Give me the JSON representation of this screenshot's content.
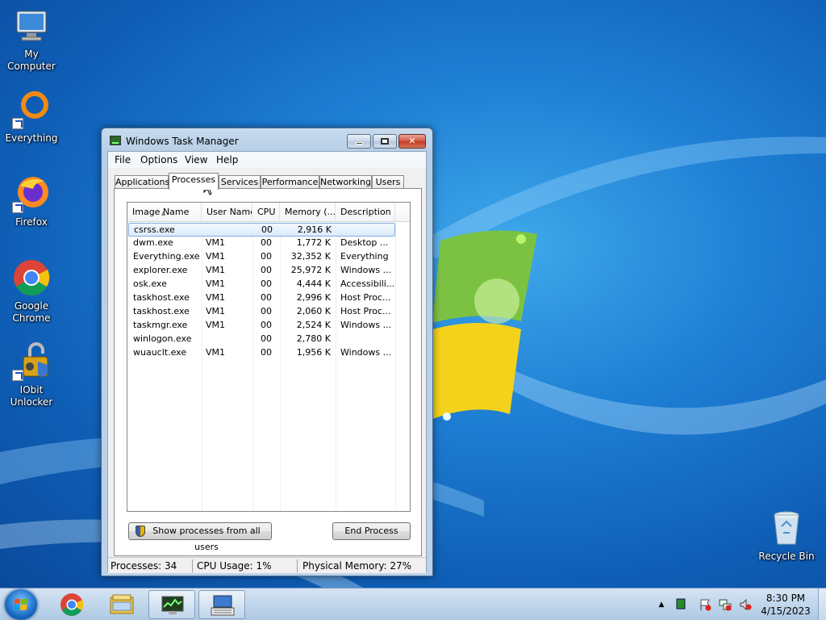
{
  "desktop": {
    "icons": [
      {
        "label": "My Computer"
      },
      {
        "label": "Everything"
      },
      {
        "label": "Firefox"
      },
      {
        "label": "Google Chrome"
      },
      {
        "label": "IObit Unlocker"
      },
      {
        "label": "Recycle Bin"
      }
    ]
  },
  "window": {
    "title": "Windows Task Manager",
    "close_glyph": "✕",
    "menus": [
      "File",
      "Options",
      "View",
      "Help"
    ],
    "tabs": [
      "Applications",
      "Processes",
      "Services",
      "Performance",
      "Networking",
      "Users"
    ],
    "active_tab": "Processes",
    "columns": [
      "Image Name",
      "User Name",
      "CPU",
      "Memory (...",
      "Description"
    ],
    "rows": [
      {
        "image": "csrss.exe",
        "user": "",
        "cpu": "00",
        "memory": "2,916 K",
        "desc": ""
      },
      {
        "image": "dwm.exe",
        "user": "VM1",
        "cpu": "00",
        "memory": "1,772 K",
        "desc": "Desktop ..."
      },
      {
        "image": "Everything.exe",
        "user": "VM1",
        "cpu": "00",
        "memory": "32,352 K",
        "desc": "Everything"
      },
      {
        "image": "explorer.exe",
        "user": "VM1",
        "cpu": "00",
        "memory": "25,972 K",
        "desc": "Windows ..."
      },
      {
        "image": "osk.exe",
        "user": "VM1",
        "cpu": "00",
        "memory": "4,444 K",
        "desc": "Accessibili..."
      },
      {
        "image": "taskhost.exe",
        "user": "VM1",
        "cpu": "00",
        "memory": "2,996 K",
        "desc": "Host Proc..."
      },
      {
        "image": "taskhost.exe",
        "user": "VM1",
        "cpu": "00",
        "memory": "2,060 K",
        "desc": "Host Proc..."
      },
      {
        "image": "taskmgr.exe",
        "user": "VM1",
        "cpu": "00",
        "memory": "2,524 K",
        "desc": "Windows ..."
      },
      {
        "image": "winlogon.exe",
        "user": "",
        "cpu": "00",
        "memory": "2,780 K",
        "desc": ""
      },
      {
        "image": "wuauclt.exe",
        "user": "VM1",
        "cpu": "00",
        "memory": "1,956 K",
        "desc": "Windows ..."
      }
    ],
    "selected_row": 0,
    "show_all_label": "Show processes from all users",
    "end_process_label": "End Process",
    "status": {
      "processes": "Processes: 34",
      "cpu": "CPU Usage: 1%",
      "memory": "Physical Memory: 27%"
    }
  },
  "taskbar": {
    "pinned": [
      "Start",
      "Google Chrome",
      "Windows Explorer",
      "Windows Task Manager",
      "On-Screen Keyboard"
    ],
    "tray_arrow": "▲",
    "clock_time": "8:30 PM",
    "clock_date": "4/15/2023"
  },
  "colors": {
    "desktop_bg": "#1e7fd4",
    "selection": "#dcebfc",
    "close_button": "#c23a20"
  }
}
